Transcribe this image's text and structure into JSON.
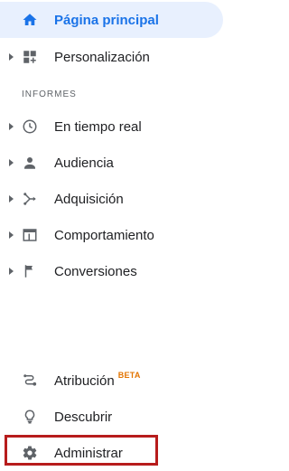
{
  "nav": {
    "home": {
      "label": "Página principal",
      "icon": "home-icon"
    },
    "customization": {
      "label": "Personalización",
      "icon": "dashboard-icon"
    },
    "section_label": "INFORMES",
    "reports": [
      {
        "label": "En tiempo real",
        "icon": "clock-icon"
      },
      {
        "label": "Audiencia",
        "icon": "person-icon"
      },
      {
        "label": "Adquisición",
        "icon": "acquisition-icon"
      },
      {
        "label": "Comportamiento",
        "icon": "behavior-icon"
      },
      {
        "label": "Conversiones",
        "icon": "flag-icon"
      }
    ],
    "attribution": {
      "label": "Atribución",
      "badge": "BETA",
      "icon": "attribution-icon"
    },
    "discover": {
      "label": "Descubrir",
      "icon": "lightbulb-icon"
    },
    "admin": {
      "label": "Administrar",
      "icon": "gear-icon"
    }
  },
  "colors": {
    "accent": "#1a73e8",
    "active_bg": "#e8f0fe",
    "beta": "#e37400",
    "highlight": "#b71c1c"
  }
}
